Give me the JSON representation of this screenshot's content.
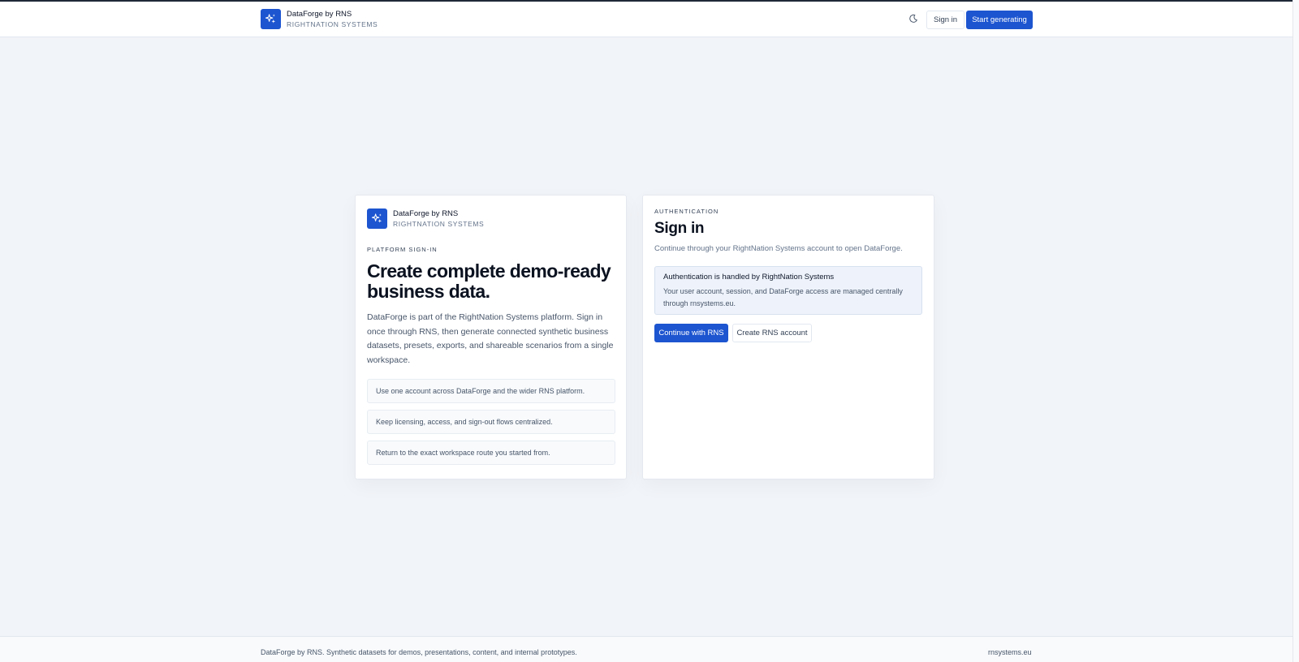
{
  "brand": {
    "name": "DataForge by RNS",
    "subtitle": "RIGHTNATION SYSTEMS"
  },
  "header": {
    "theme_icon": "moon-icon",
    "signin_label": "Sign in",
    "start_label": "Start generating"
  },
  "left_card": {
    "eyebrow": "PLATFORM SIGN-IN",
    "title": "Create complete demo-ready business data.",
    "body": "DataForge is part of the RightNation Systems platform. Sign in once through RNS, then generate connected synthetic business datasets, presets, exports, and shareable scenarios from a single workspace.",
    "features": [
      "Use one account across DataForge and the wider RNS platform.",
      "Keep licensing, access, and sign-out flows centralized.",
      "Return to the exact workspace route you started from."
    ]
  },
  "right_card": {
    "eyebrow": "AUTHENTICATION",
    "title": "Sign in",
    "description": "Continue through your RightNation Systems account to open DataForge.",
    "notice_title": "Authentication is handled by RightNation Systems",
    "notice_body": "Your user account, session, and DataForge access are managed centrally through rnsystems.eu.",
    "continue_label": "Continue with RNS",
    "create_label": "Create RNS account"
  },
  "footer": {
    "text": "DataForge by RNS. Synthetic datasets for demos, presentations, content, and internal prototypes.",
    "link": "rnsystems.eu"
  },
  "colors": {
    "accent": "#1d55d0",
    "background": "#f1f4f8"
  }
}
